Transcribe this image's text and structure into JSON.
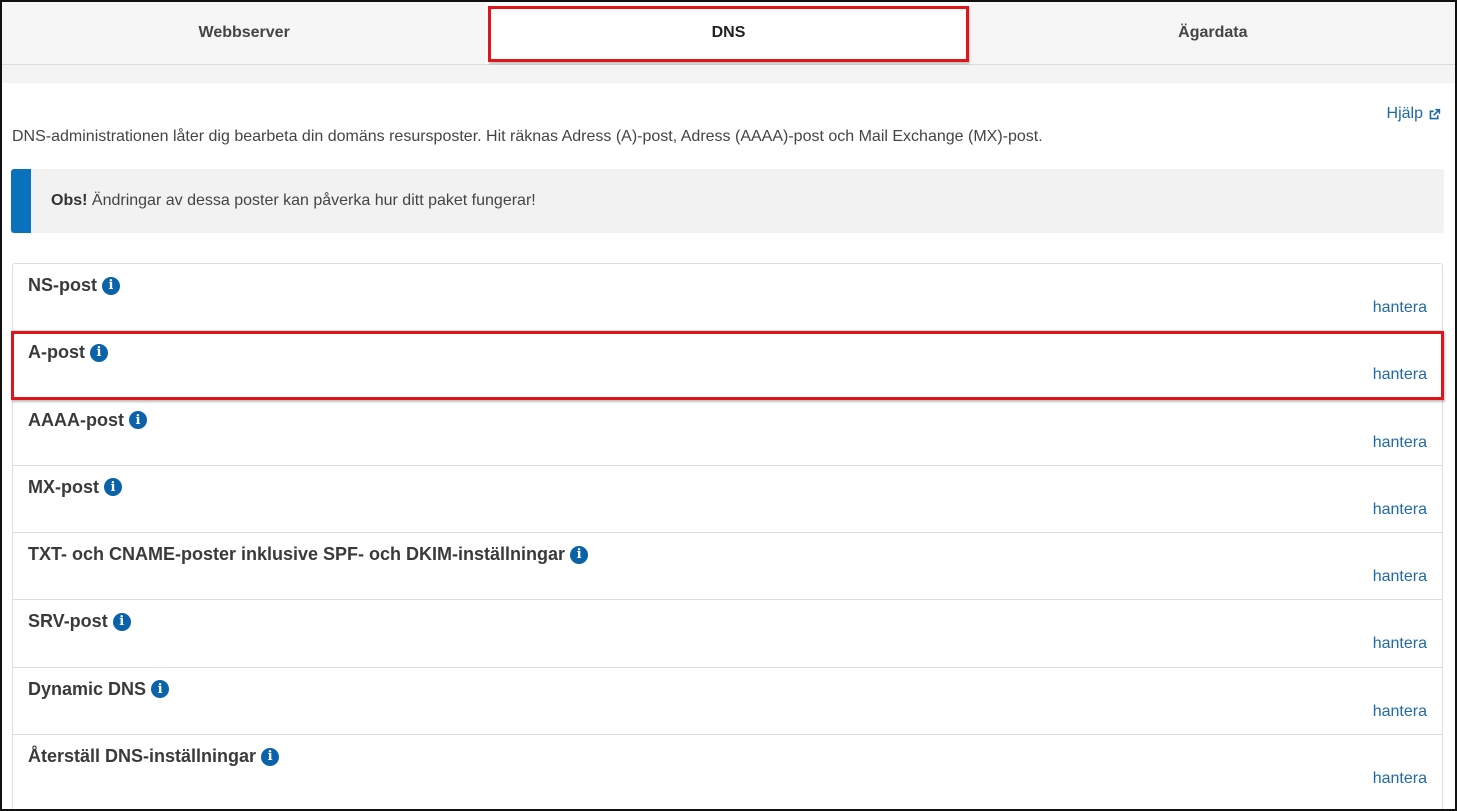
{
  "tabs": [
    {
      "label": "Webbserver",
      "active": false
    },
    {
      "label": "DNS",
      "active": true
    },
    {
      "label": "Ägardata",
      "active": false
    }
  ],
  "help": {
    "label": "Hjälp",
    "icon": "external-link-icon"
  },
  "intro": "DNS-administrationen låter dig bearbeta din domäns resursposter. Hit räknas Adress (A)-post, Adress (AAAA)-post och Mail Exchange (MX)-post.",
  "notice": {
    "label": "Obs!",
    "text": " Ändringar av dessa poster kan påverka hur ditt paket fungerar!"
  },
  "records": [
    {
      "title": "NS-post",
      "action": "hantera"
    },
    {
      "title": "A-post",
      "action": "hantera"
    },
    {
      "title": "AAAA-post",
      "action": "hantera"
    },
    {
      "title": "MX-post",
      "action": "hantera"
    },
    {
      "title": "TXT- och CNAME-poster inklusive SPF- och DKIM-inställningar",
      "action": "hantera"
    },
    {
      "title": "SRV-post",
      "action": "hantera"
    },
    {
      "title": "Dynamic DNS",
      "action": "hantera"
    },
    {
      "title": "Återställ DNS-inställningar",
      "action": "hantera"
    }
  ],
  "colors": {
    "accent": "#0a72bd",
    "link": "#1f6aa5",
    "highlight": "#e0141b"
  }
}
